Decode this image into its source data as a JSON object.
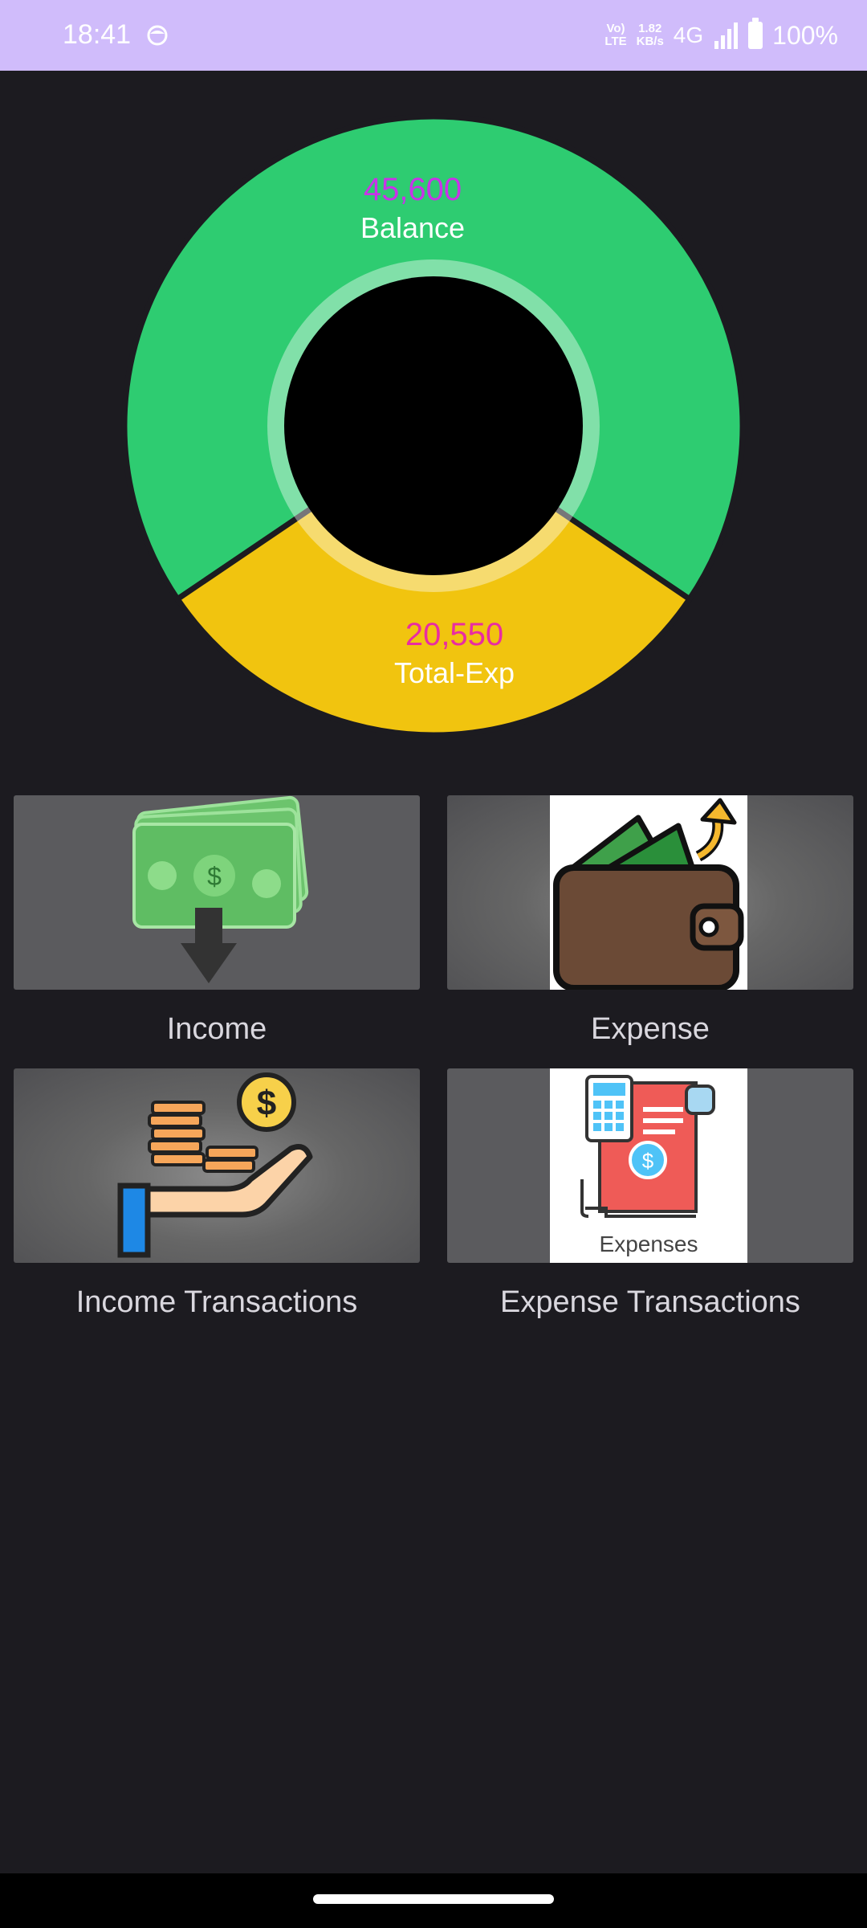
{
  "status": {
    "time": "18:41",
    "volte_top": "Vo)",
    "volte_bottom": "LTE",
    "speed_top": "1.82",
    "speed_bottom": "KB/s",
    "network": "4G",
    "battery": "100%"
  },
  "chart_data": {
    "type": "pie",
    "categories": [
      "Balance",
      "Total-Exp"
    ],
    "values": [
      45600,
      20550
    ],
    "value_labels": [
      "45,600",
      "20,550"
    ],
    "colors": [
      "#2ecc71",
      "#f1c40f"
    ]
  },
  "cards": {
    "income": {
      "label": "Income",
      "icon": "money-down-icon"
    },
    "expense": {
      "label": "Expense",
      "icon": "wallet-icon"
    },
    "income_tx": {
      "label": "Income Transactions",
      "icon": "coins-hand-icon"
    },
    "expense_tx": {
      "label": "Expense Transactions",
      "icon": "expenses-receipt-icon",
      "image_text": "Expenses"
    }
  }
}
